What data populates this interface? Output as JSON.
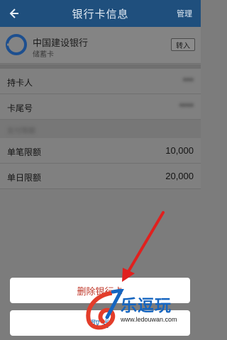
{
  "navbar": {
    "back_icon": "back-arrow-icon",
    "title": "银行卡信息",
    "right_action": "管理"
  },
  "card": {
    "bank_name": "中国建设银行",
    "card_type": "储蓄卡",
    "transfer_label": "转入",
    "logo_icon": "ccb-logo-icon",
    "logo_color": "#1d4f8f"
  },
  "details": {
    "holder_label": "持卡人",
    "holder_value": "***",
    "tail_label": "卡尾号",
    "tail_value": "****",
    "group_label": "支付限额",
    "single_limit_label": "单笔限额",
    "single_limit_value": "10,000",
    "daily_limit_label": "单日限额",
    "daily_limit_value": "20,000"
  },
  "action_sheet": {
    "delete_label": "删除银行卡",
    "cancel_label": "取消"
  },
  "watermark": {
    "brand": "乐逗玩",
    "url": "www.ledouwan.com"
  },
  "colors": {
    "navbar": "#1f4f7d",
    "delete_text": "#c0392b",
    "cancel_text": "#1f6fb5",
    "arrow": "#e0201e"
  }
}
